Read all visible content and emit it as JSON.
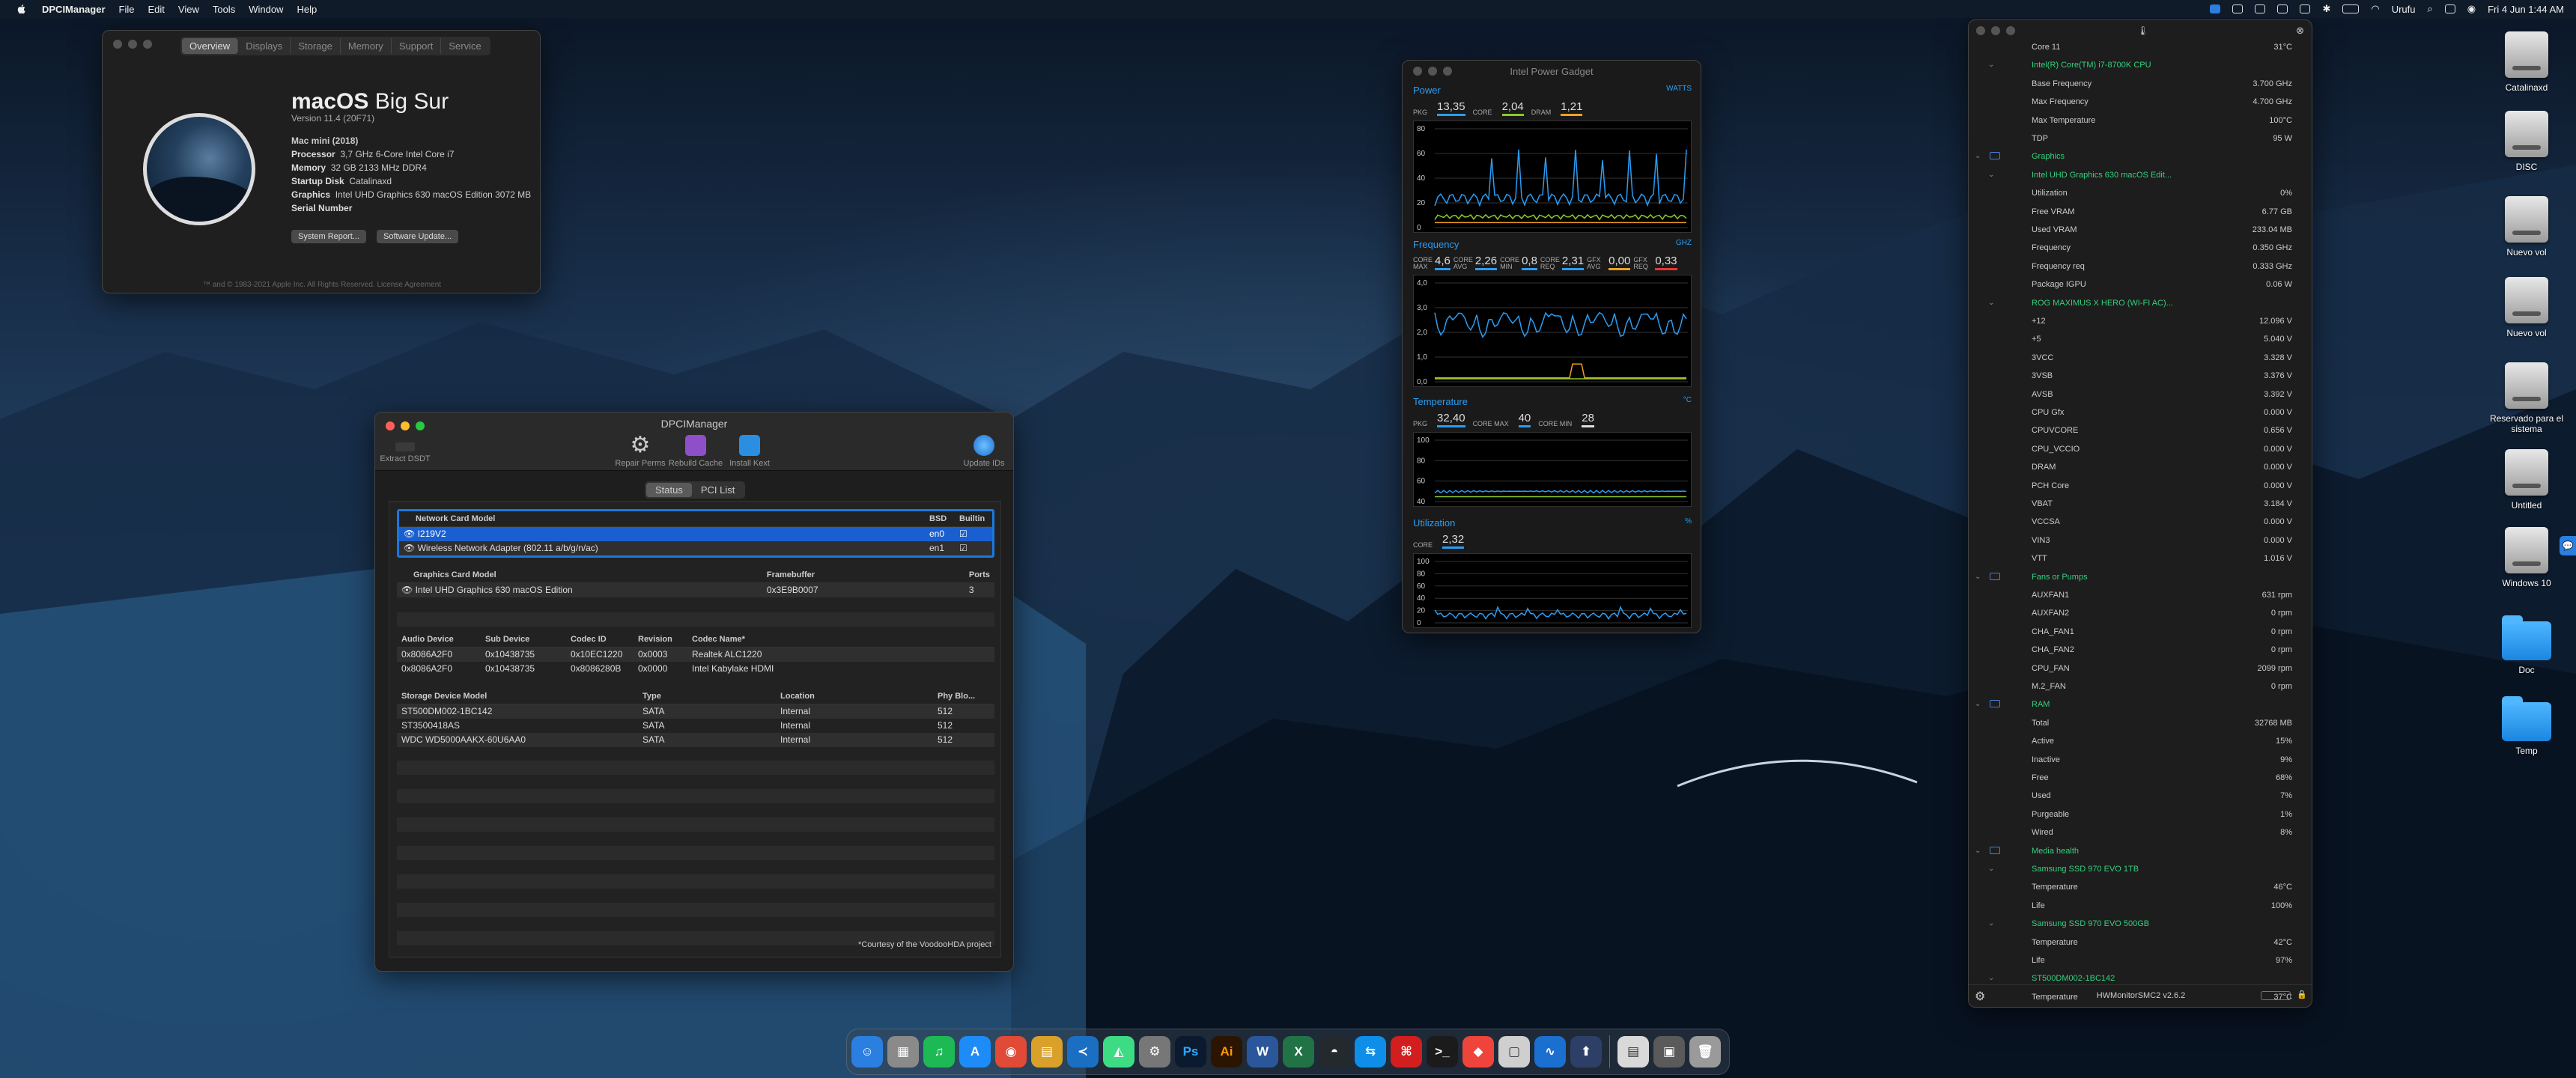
{
  "menubar": {
    "app": "DPCIManager",
    "items": [
      "File",
      "Edit",
      "View",
      "Tools",
      "Window",
      "Help"
    ],
    "user": "Urufu",
    "datetime": "Fri 4 Jun  1:44 AM"
  },
  "about": {
    "tabs": [
      "Overview",
      "Displays",
      "Storage",
      "Memory",
      "Support",
      "Service"
    ],
    "title_bold": "macOS",
    "title_rest": " Big Sur",
    "version": "Version 11.4 (20F71)",
    "model": "Mac mini (2018)",
    "rows": [
      {
        "k": "Processor",
        "v": "3,7 GHz 6-Core Intel Core i7"
      },
      {
        "k": "Memory",
        "v": "32 GB 2133 MHz DDR4"
      },
      {
        "k": "Startup Disk",
        "v": "Catalinaxd"
      },
      {
        "k": "Graphics",
        "v": "Intel UHD Graphics 630 macOS Edition 3072 MB"
      },
      {
        "k": "Serial Number",
        "v": ""
      }
    ],
    "btn_report": "System Report...",
    "btn_update": "Software Update...",
    "footer": "™ and © 1983-2021 Apple Inc. All Rights Reserved. License Agreement"
  },
  "dpci": {
    "title": "DPCIManager",
    "tools": {
      "extract": "Extract DSDT",
      "repair": "Repair Perms",
      "rebuild": "Rebuild Cache",
      "install": "Install Kext",
      "update": "Update IDs"
    },
    "tabs": [
      "Status",
      "PCI List"
    ],
    "net_headers": [
      "Network Card Model",
      "BSD",
      "Builtin"
    ],
    "net_rows": [
      {
        "model": "I219V2",
        "bsd": "en0"
      },
      {
        "model": "Wireless Network Adapter (802.11 a/b/g/n/ac)",
        "bsd": "en1"
      }
    ],
    "gfx_headers": [
      "Graphics Card Model",
      "Framebuffer",
      "Ports"
    ],
    "gfx_rows": [
      {
        "model": "Intel UHD Graphics 630 macOS Edition",
        "fb": "0x3E9B0007",
        "ports": "3"
      }
    ],
    "audio_headers": [
      "Audio Device",
      "Sub Device",
      "Codec ID",
      "Revision",
      "Codec Name*"
    ],
    "audio_rows": [
      [
        "0x8086A2F0",
        "0x10438735",
        "0x10EC1220",
        "0x0003",
        "Realtek ALC1220"
      ],
      [
        "0x8086A2F0",
        "0x10438735",
        "0x8086280B",
        "0x0000",
        "Intel Kabylake HDMI"
      ]
    ],
    "storage_headers": [
      "Storage Device Model",
      "Type",
      "Location",
      "Phy Blo..."
    ],
    "storage_rows": [
      [
        "ST500DM002-1BC142",
        "SATA",
        "Internal",
        "512"
      ],
      [
        "ST3500418AS",
        "SATA",
        "Internal",
        "512"
      ],
      [
        "WDC WD5000AAKX-60U6AA0",
        "SATA",
        "Internal",
        "512"
      ]
    ],
    "courtesy": "*Courtesy of the VoodooHDA project"
  },
  "gadget": {
    "title": "Intel Power Gadget",
    "power": {
      "label": "Power",
      "unit": "WATTS",
      "k1": "PKG",
      "v1": "13,35",
      "k2": "CORE",
      "v2": "2,04",
      "k3": "DRAM",
      "v3": "1,21",
      "ticks": [
        "80",
        "60",
        "40",
        "20",
        "0"
      ]
    },
    "freq": {
      "label": "Frequency",
      "unit": "GHZ",
      "items": [
        {
          "k": "CORE MAX",
          "v": "4,6"
        },
        {
          "k": "CORE AVG",
          "v": "2,26"
        },
        {
          "k": "CORE MIN",
          "v": "0,8"
        },
        {
          "k": "CORE REQ",
          "v": "2,31"
        },
        {
          "k": "GFX AVG",
          "v": "0,00"
        },
        {
          "k": "GFX REQ",
          "v": "0,33"
        }
      ],
      "ticks": [
        "4,0",
        "3,0",
        "2,0",
        "1,0",
        "0,0"
      ]
    },
    "temp": {
      "label": "Temperature",
      "unit": "°C",
      "k1": "PKG",
      "v1": "32,40",
      "k2": "CORE MAX",
      "v2": "40",
      "k3": "CORE MIN",
      "v3": "28",
      "ticks": [
        "100",
        "80",
        "60",
        "40"
      ]
    },
    "util": {
      "label": "Utilization",
      "unit": "%",
      "k1": "CORE",
      "v1": "2,32",
      "ticks": [
        "100",
        "80",
        "60",
        "40",
        "20",
        "0"
      ]
    },
    "colors": {
      "blue": "#2a9df4",
      "orange": "#f0a020",
      "green": "#8ac926"
    }
  },
  "hwm": {
    "rows": [
      {
        "t": "row",
        "l": "Core 11",
        "v": "31°C"
      },
      {
        "t": "grp2",
        "l": "Intel(R) Core(TM) i7-8700K CPU"
      },
      {
        "t": "row",
        "l": "Base Frequency",
        "v": "3.700 GHz"
      },
      {
        "t": "row",
        "l": "Max Frequency",
        "v": "4.700 GHz"
      },
      {
        "t": "row",
        "l": "Max Temperature",
        "v": "100°C"
      },
      {
        "t": "row",
        "l": "TDP",
        "v": "95 W"
      },
      {
        "t": "grp",
        "l": "Graphics"
      },
      {
        "t": "grp2",
        "l": "Intel UHD Graphics 630 macOS Edit..."
      },
      {
        "t": "row",
        "l": "Utilization",
        "v": "0%"
      },
      {
        "t": "row",
        "l": "Free VRAM",
        "v": "6.77 GB"
      },
      {
        "t": "row",
        "l": "Used VRAM",
        "v": "233.04 MB"
      },
      {
        "t": "row",
        "l": "Frequency",
        "v": "0.350 GHz"
      },
      {
        "t": "row",
        "l": "Frequency req",
        "v": "0.333 GHz"
      },
      {
        "t": "row",
        "l": "Package IGPU",
        "v": "0.06 W"
      },
      {
        "t": "grp2",
        "l": "ROG MAXIMUS X HERO (WI-FI AC)..."
      },
      {
        "t": "row",
        "l": "+12",
        "v": "12.096 V"
      },
      {
        "t": "row",
        "l": "+5",
        "v": "5.040 V"
      },
      {
        "t": "row",
        "l": "3VCC",
        "v": "3.328 V"
      },
      {
        "t": "row",
        "l": "3VSB",
        "v": "3.376 V"
      },
      {
        "t": "row",
        "l": "AVSB",
        "v": "3.392 V"
      },
      {
        "t": "row",
        "l": "CPU Gfx",
        "v": "0.000 V"
      },
      {
        "t": "row",
        "l": "CPUVCORE",
        "v": "0.656 V"
      },
      {
        "t": "row",
        "l": "CPU_VCCIO",
        "v": "0.000 V"
      },
      {
        "t": "row",
        "l": "DRAM",
        "v": "0.000 V"
      },
      {
        "t": "row",
        "l": "PCH Core",
        "v": "0.000 V"
      },
      {
        "t": "row",
        "l": "VBAT",
        "v": "3.184 V"
      },
      {
        "t": "row",
        "l": "VCCSA",
        "v": "0.000 V"
      },
      {
        "t": "row",
        "l": "VIN3",
        "v": "0.000 V"
      },
      {
        "t": "row",
        "l": "VTT",
        "v": "1.016 V"
      },
      {
        "t": "grp",
        "l": "Fans or Pumps"
      },
      {
        "t": "row",
        "l": "AUXFAN1",
        "v": "631 rpm"
      },
      {
        "t": "row",
        "l": "AUXFAN2",
        "v": "0 rpm"
      },
      {
        "t": "row",
        "l": "CHA_FAN1",
        "v": "0 rpm"
      },
      {
        "t": "row",
        "l": "CHA_FAN2",
        "v": "0 rpm"
      },
      {
        "t": "row",
        "l": "CPU_FAN",
        "v": "2099 rpm"
      },
      {
        "t": "row",
        "l": "M.2_FAN",
        "v": "0 rpm"
      },
      {
        "t": "grp",
        "l": "RAM"
      },
      {
        "t": "row",
        "l": "Total",
        "v": "32768 MB"
      },
      {
        "t": "row",
        "l": "Active",
        "v": "15%"
      },
      {
        "t": "row",
        "l": "Inactive",
        "v": "9%"
      },
      {
        "t": "row",
        "l": "Free",
        "v": "68%"
      },
      {
        "t": "row",
        "l": "Used",
        "v": "7%"
      },
      {
        "t": "row",
        "l": "Purgeable",
        "v": "1%"
      },
      {
        "t": "row",
        "l": "Wired",
        "v": "8%"
      },
      {
        "t": "grp",
        "l": "Media health"
      },
      {
        "t": "grp2",
        "l": "Samsung SSD 970 EVO 1TB"
      },
      {
        "t": "row",
        "l": "Temperature",
        "v": "46°C"
      },
      {
        "t": "row",
        "l": "Life",
        "v": "100%"
      },
      {
        "t": "grp2",
        "l": "Samsung SSD 970 EVO 500GB"
      },
      {
        "t": "row",
        "l": "Temperature",
        "v": "42°C"
      },
      {
        "t": "row",
        "l": "Life",
        "v": "97%"
      },
      {
        "t": "grp2",
        "l": "ST500DM002-1BC142"
      },
      {
        "t": "row",
        "l": "Temperature",
        "v": "37°C"
      }
    ],
    "footer": "HWMonitorSMC2 v2.6.2"
  },
  "desktop": [
    "Catalinaxd",
    "DISC",
    "Nuevo vol",
    "Nuevo vol",
    "Reservado para el sistema",
    "Untitled",
    "Windows 10",
    "Doc",
    "Temp"
  ],
  "dock": [
    {
      "n": "finder",
      "c": "#2a7fe0",
      "g": "☺"
    },
    {
      "n": "launchpad",
      "c": "#8a8a8a",
      "g": "▦"
    },
    {
      "n": "spotify",
      "c": "#1db954",
      "g": "♫"
    },
    {
      "n": "app-store",
      "c": "#1d8cf8",
      "g": "A"
    },
    {
      "n": "chrome",
      "c": "#e04a36",
      "g": "◉"
    },
    {
      "n": "database",
      "c": "#d9a12a",
      "g": "▤"
    },
    {
      "n": "vscode",
      "c": "#1b6fc2",
      "g": "≺"
    },
    {
      "n": "android-studio",
      "c": "#3ddc84",
      "g": "◭"
    },
    {
      "n": "system-preferences",
      "c": "#777",
      "g": "⚙"
    },
    {
      "n": "photoshop",
      "c": "#0c1a2f",
      "g": "Ps"
    },
    {
      "n": "illustrator",
      "c": "#2b1400",
      "g": "Ai"
    },
    {
      "n": "word",
      "c": "#2b579a",
      "g": "W"
    },
    {
      "n": "excel",
      "c": "#217346",
      "g": "X"
    },
    {
      "n": "github",
      "c": "#24292e",
      "g": "◓"
    },
    {
      "n": "teamviewer",
      "c": "#0e8ee9",
      "g": "⇆"
    },
    {
      "n": "acrobat",
      "c": "#d21e1e",
      "g": "⌘"
    },
    {
      "n": "terminal",
      "c": "#1b1b1b",
      "g": ">_"
    },
    {
      "n": "anydesk",
      "c": "#ef443b",
      "g": "◆"
    },
    {
      "n": "preview",
      "c": "#cfcfcf",
      "g": "▢"
    },
    {
      "n": "power-gadget",
      "c": "#1a6fcf",
      "g": "∿"
    },
    {
      "n": "kext-utility",
      "c": "#2d3f66",
      "g": "⬆"
    },
    {
      "n": "documents",
      "c": "#d9d9d9",
      "g": "▤"
    },
    {
      "n": "downloads",
      "c": "#5a5a5a",
      "g": "▣"
    },
    {
      "n": "trash",
      "c": "#9a9a9a",
      "g": "🗑"
    }
  ]
}
